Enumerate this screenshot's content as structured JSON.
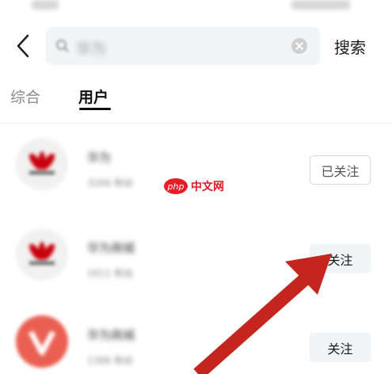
{
  "header": {
    "search_value": "华为",
    "search_button": "搜索"
  },
  "tabs": [
    {
      "label": "综合",
      "active": false
    },
    {
      "label": "用户",
      "active": true
    }
  ],
  "results": [
    {
      "name": "华为",
      "meta": "3266 粉丝",
      "button": "已关注",
      "state": "followed"
    },
    {
      "name": "华为商城",
      "meta": "1611 粉丝",
      "button": "关注",
      "state": "not-followed"
    },
    {
      "name": "华为商城",
      "meta": "1366 粉丝",
      "button": "关注",
      "state": "not-followed"
    }
  ],
  "overlay": {
    "watermark_badge": "php",
    "watermark_text": "中文网",
    "arrow_color": "#c4261f"
  },
  "colors": {
    "brand_red": "#c7000b",
    "tab_indicator": "#111111",
    "search_bg": "#f3f4f6"
  }
}
